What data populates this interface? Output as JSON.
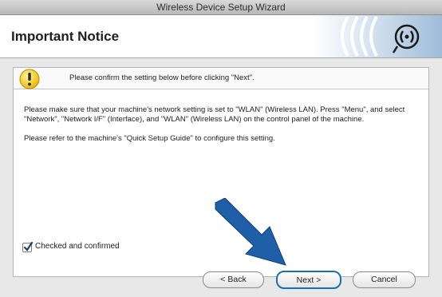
{
  "window": {
    "title": "Wireless Device Setup Wizard"
  },
  "header": {
    "title": "Important Notice",
    "logo_icon": "wireless-signal-icon"
  },
  "notice": {
    "icon": "warning-icon",
    "text": "Please confirm the setting below before clicking \"Next\"."
  },
  "body": {
    "paragraph1": "Please make sure that your machine's network setting is set to \"WLAN\" (Wireless LAN). Press \"Menu\", and select \"Network\", \"Network I/F\" (Interface), and \"WLAN\" (Wireless LAN) on the control panel of the machine.",
    "paragraph2": "Please refer to the machine's \"Quick Setup Guide\" to configure this setting."
  },
  "confirm_checkbox": {
    "label": "Checked and confirmed",
    "checked": true
  },
  "buttons": {
    "back": "< Back",
    "next": "Next >",
    "cancel": "Cancel"
  },
  "colors": {
    "accent": "#1a6fb0",
    "arrow": "#1e5fa8"
  }
}
